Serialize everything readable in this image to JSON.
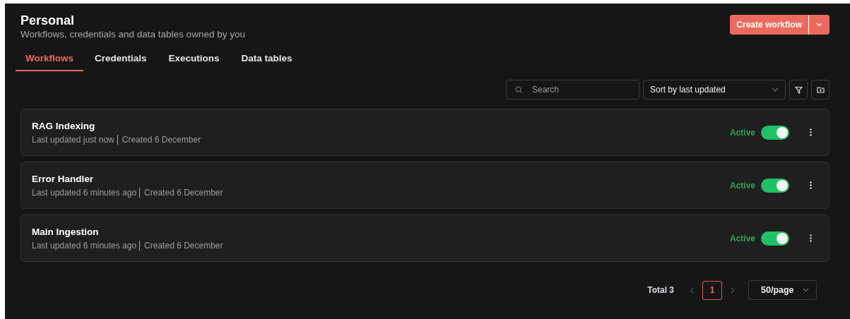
{
  "header": {
    "title": "Personal",
    "subtitle": "Workflows, credentials and data tables owned by you"
  },
  "create_button": {
    "label": "Create workflow"
  },
  "tabs": [
    {
      "label": "Workflows",
      "selected": true
    },
    {
      "label": "Credentials",
      "selected": false
    },
    {
      "label": "Executions",
      "selected": false
    },
    {
      "label": "Data tables",
      "selected": false
    }
  ],
  "search": {
    "placeholder": "Search"
  },
  "sort": {
    "value": "Sort by last updated"
  },
  "workflows": [
    {
      "name": "RAG Indexing",
      "updated": "Last updated just now",
      "created": "Created 6 December",
      "status": "Active",
      "active": true
    },
    {
      "name": "Error Handler",
      "updated": "Last updated 6 minutes ago",
      "created": "Created 6 December",
      "status": "Active",
      "active": true
    },
    {
      "name": "Main Ingestion",
      "updated": "Last updated 6 minutes ago",
      "created": "Created 6 December",
      "status": "Active",
      "active": true
    }
  ],
  "pagination": {
    "total": "Total 3",
    "pages": [
      {
        "label": "1",
        "selected": true
      }
    ],
    "page_size": "50/page"
  }
}
